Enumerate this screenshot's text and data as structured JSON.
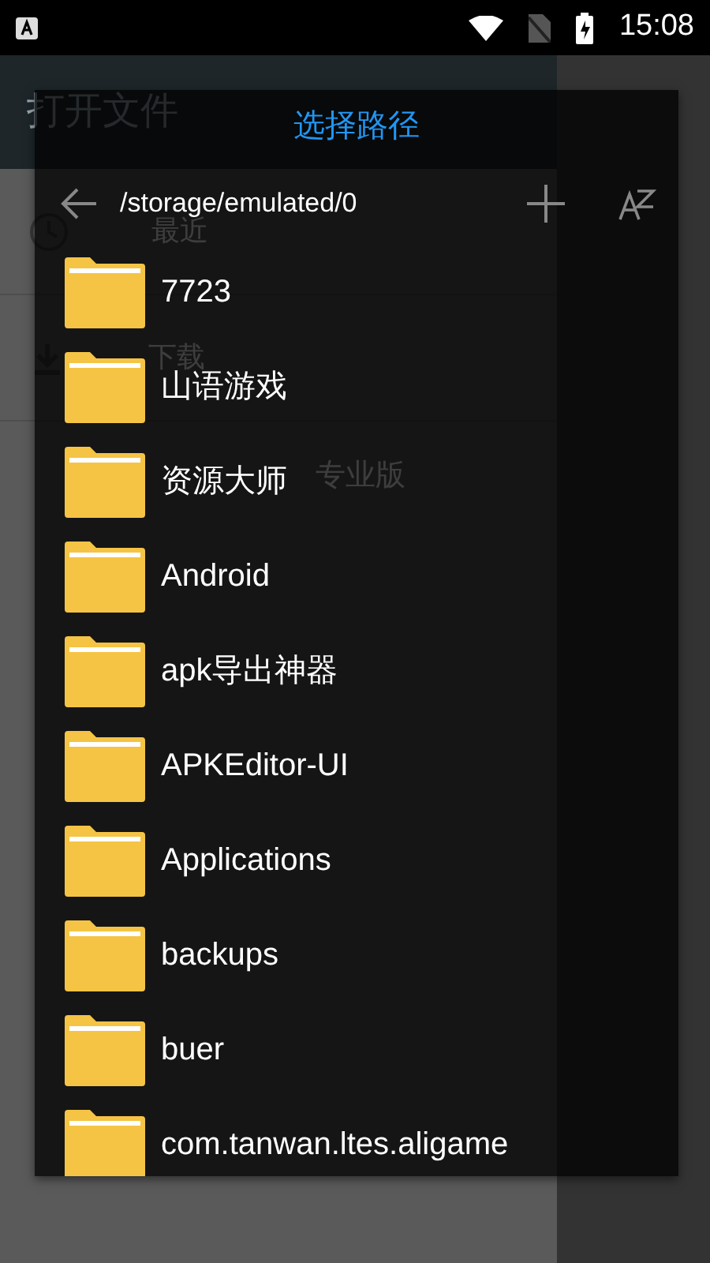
{
  "status_bar": {
    "time": "15:08"
  },
  "background_app": {
    "title": "打开文件",
    "items": [
      {
        "kind": "recent",
        "label": "最近"
      },
      {
        "kind": "download",
        "label": "下载"
      },
      {
        "kind": "app",
        "label": "专业版"
      }
    ]
  },
  "dialog": {
    "title": "选择路径",
    "path": "/storage/emulated/0",
    "folders": [
      {
        "name": "7723"
      },
      {
        "name": "山语游戏"
      },
      {
        "name": "资源大师"
      },
      {
        "name": "Android"
      },
      {
        "name": "apk导出神器"
      },
      {
        "name": "APKEditor-UI"
      },
      {
        "name": "Applications"
      },
      {
        "name": "backups"
      },
      {
        "name": "buer"
      },
      {
        "name": "com.tanwan.ltes.aligame"
      }
    ]
  }
}
